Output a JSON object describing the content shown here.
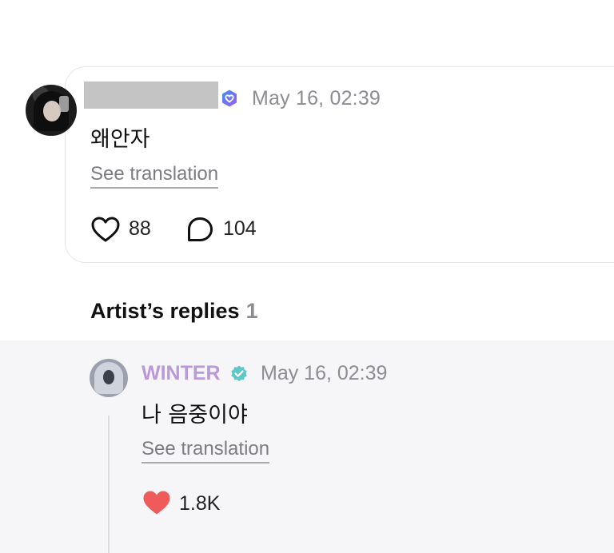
{
  "post": {
    "time": "May 16, 02:39",
    "body": "왜안자",
    "see_translation": "See translation",
    "likes": "88",
    "comments": "104"
  },
  "artist_replies": {
    "title": "Artist’s replies",
    "count": "1"
  },
  "reply": {
    "author": "WINTER",
    "time": "May 16, 02:39",
    "body": "나 음중이야",
    "see_translation": "See translation",
    "likes": "1.8K",
    "liked": true
  },
  "colors": {
    "artist_name": "#b99ad9",
    "liked_heart": "#ef5b5b",
    "verified_badge": "#5ec7c9",
    "member_badge": "#8a6cf0",
    "reply_background": "#f6f6f8"
  },
  "icons": {
    "member_badge": "member-badge-icon",
    "verified_badge": "verified-badge-icon",
    "like": "heart-outline-icon",
    "comment": "comment-bubble-icon",
    "reply_like": "heart-filled-icon"
  }
}
